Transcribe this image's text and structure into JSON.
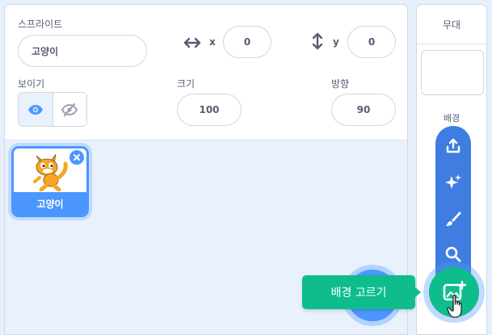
{
  "sprite_info": {
    "sprite_label": "스프라이트",
    "sprite_name": "고양이",
    "x_label": "x",
    "x_value": "0",
    "y_label": "y",
    "y_value": "0",
    "show_label": "보이기",
    "size_label": "크기",
    "size_value": "100",
    "direction_label": "방향",
    "direction_value": "90"
  },
  "sprite_list": {
    "items": [
      {
        "label": "고양이",
        "selected": true
      }
    ]
  },
  "stage": {
    "title": "무대",
    "backdrop_label": "배경",
    "menu_icons": [
      "upload-icon",
      "sparkle-icon",
      "paint-icon",
      "search-icon"
    ]
  },
  "tooltip": {
    "text": "배경 고르기"
  },
  "colors": {
    "accent_blue": "#4c97ff",
    "menu_blue": "#3f7ee0",
    "green": "#0fbd8c",
    "text": "#575e75"
  }
}
